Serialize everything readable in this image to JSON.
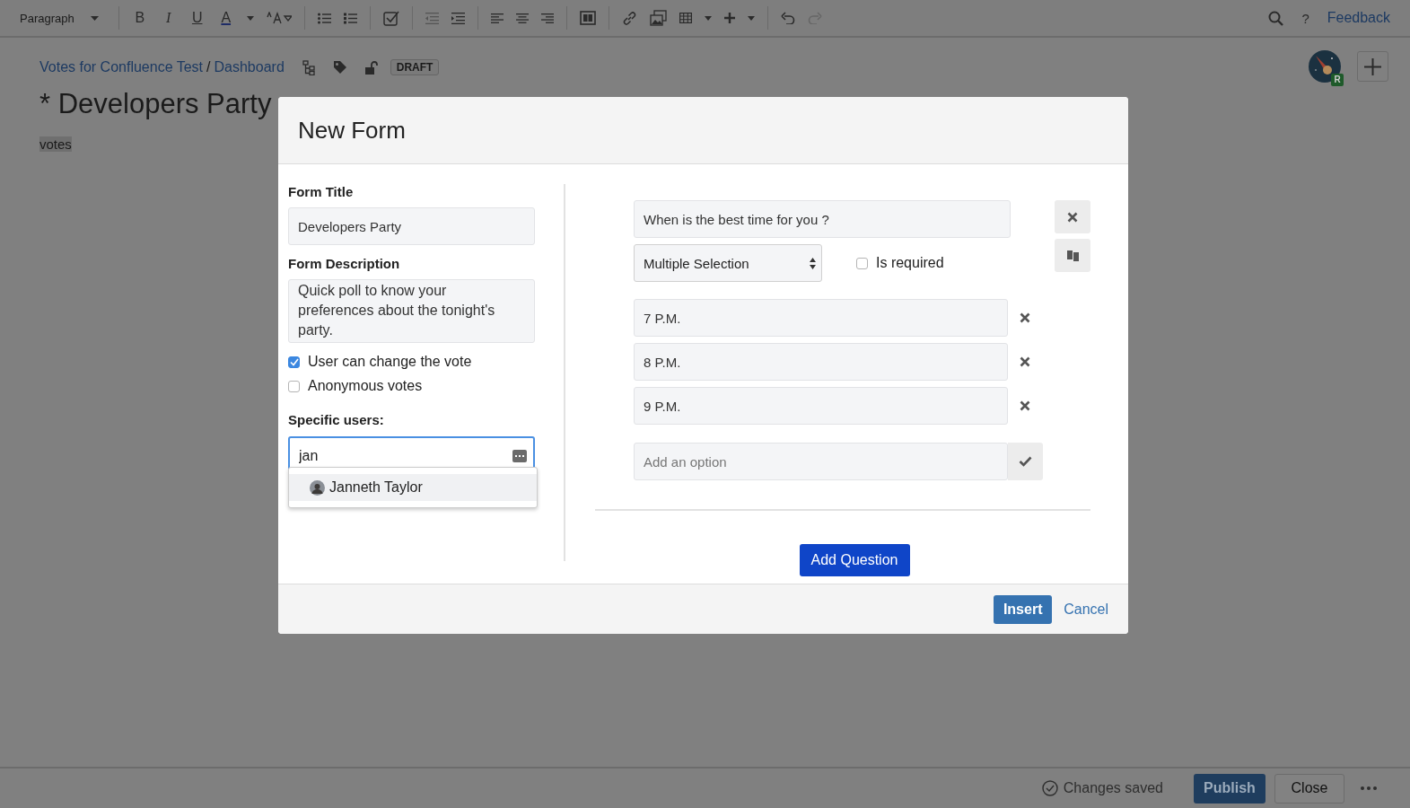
{
  "toolbar": {
    "style_dropdown": "Paragraph",
    "format_buttons": [
      "B",
      "I",
      "U",
      "A"
    ],
    "help": "?",
    "feedback": "Feedback"
  },
  "breadcrumbs": {
    "items": [
      "Votes for Confluence Test",
      "Dashboard"
    ],
    "separator": "/"
  },
  "status_badge": "DRAFT",
  "page_title": "* Developers Party",
  "page_body": "votes",
  "avatar_badge": "R",
  "modal": {
    "title": "New Form",
    "form_title": {
      "label": "Form Title",
      "value": "Developers Party"
    },
    "form_description": {
      "label": "Form Description",
      "value": "Quick poll to know your preferences about the tonight's party."
    },
    "settings": [
      {
        "label": "User can change the vote",
        "checked": true
      },
      {
        "label": "Anonymous votes",
        "checked": false
      }
    ],
    "specific_users": {
      "label": "Specific users:",
      "value": "jan",
      "suggestions": [
        {
          "name": "Janneth Taylor",
          "selected": true
        }
      ]
    },
    "question": {
      "text": "When is the best time for you ?",
      "type": "Multiple Selection",
      "required": {
        "label": "Is required",
        "checked": false
      },
      "options": [
        "7 P.M.",
        "8 P.M.",
        "9 P.M."
      ],
      "add_option": {
        "placeholder": "Add an option"
      }
    },
    "add_question": "Add Question",
    "insert": "Insert",
    "cancel": "Cancel"
  },
  "status_bar": {
    "status": "Changes saved",
    "publish": "Publish",
    "close": "Close"
  }
}
